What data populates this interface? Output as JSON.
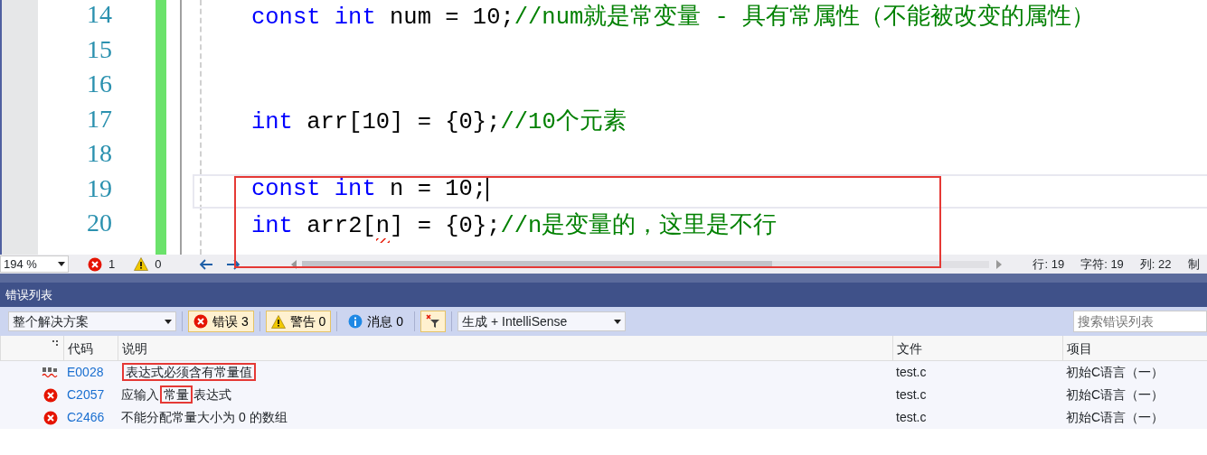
{
  "editor": {
    "lines": [
      {
        "number": "14",
        "current": false,
        "tokens": [
          {
            "kind": "keyword",
            "text": "const"
          },
          {
            "kind": "keyword",
            "text": " int"
          },
          {
            "kind": "plain",
            "text": " num = 10;"
          },
          {
            "kind": "comment",
            "text": "//num就是常变量 - 具有常属性（不能被改变的属性）"
          }
        ]
      },
      {
        "number": "15",
        "current": false
      },
      {
        "number": "16",
        "current": false
      },
      {
        "number": "17",
        "current": false,
        "tokens": [
          {
            "kind": "keyword",
            "text": "int"
          },
          {
            "kind": "plain",
            "text": " arr[10] = {0};"
          },
          {
            "kind": "comment",
            "text": "//10个元素"
          }
        ]
      },
      {
        "number": "18",
        "current": false
      },
      {
        "number": "19",
        "current": true,
        "tokens": [
          {
            "kind": "keyword",
            "text": "const"
          },
          {
            "kind": "keyword",
            "text": " int"
          },
          {
            "kind": "plain",
            "text": " n = 10;"
          }
        ]
      },
      {
        "number": "20",
        "current": false,
        "tokens": [
          {
            "kind": "keyword",
            "text": "int"
          },
          {
            "kind": "plain",
            "text": " arr2["
          },
          {
            "kind": "error",
            "text": "n"
          },
          {
            "kind": "plain",
            "text": "] = {0};"
          },
          {
            "kind": "comment",
            "text": "//n是变量的，这里是不行"
          }
        ]
      }
    ]
  },
  "status_bar": {
    "zoom": "194 %",
    "errors": "1",
    "warnings": "0",
    "line": "行: 19",
    "char": "字符: 19",
    "col": "列: 22",
    "cut": "制"
  },
  "error_list": {
    "title": "错误列表",
    "scope": "整个解决方案",
    "filters": [
      {
        "kind": "error",
        "label": "错误 3",
        "selected": true
      },
      {
        "kind": "warning",
        "label": "警告 0",
        "selected": true
      },
      {
        "kind": "info",
        "label": "消息 0",
        "selected": false
      }
    ],
    "source": "生成 + IntelliSense",
    "search": {
      "placeholder": "搜索错误列表"
    },
    "columns": [
      "代码",
      "说明",
      "文件",
      "项目"
    ],
    "rows": [
      {
        "kind": "spelling",
        "code": "E0028",
        "description": [
          {
            "text": "表达式必须含有常量值",
            "boxed": true
          }
        ],
        "file": "test.c",
        "project": "初始C语言（一）"
      },
      {
        "kind": "error",
        "code": "C2057",
        "description": [
          {
            "text": "应输入",
            "boxed": false
          },
          {
            "text": "常量",
            "boxed": true
          },
          {
            "text": "表达式",
            "boxed": false
          }
        ],
        "file": "test.c",
        "project": "初始C语言（一）"
      },
      {
        "kind": "error",
        "code": "C2466",
        "description": [
          {
            "text": "不能分配常量大小为 0 的数组",
            "boxed": false
          }
        ],
        "file": "test.c",
        "project": "初始C语言（一）"
      }
    ]
  }
}
